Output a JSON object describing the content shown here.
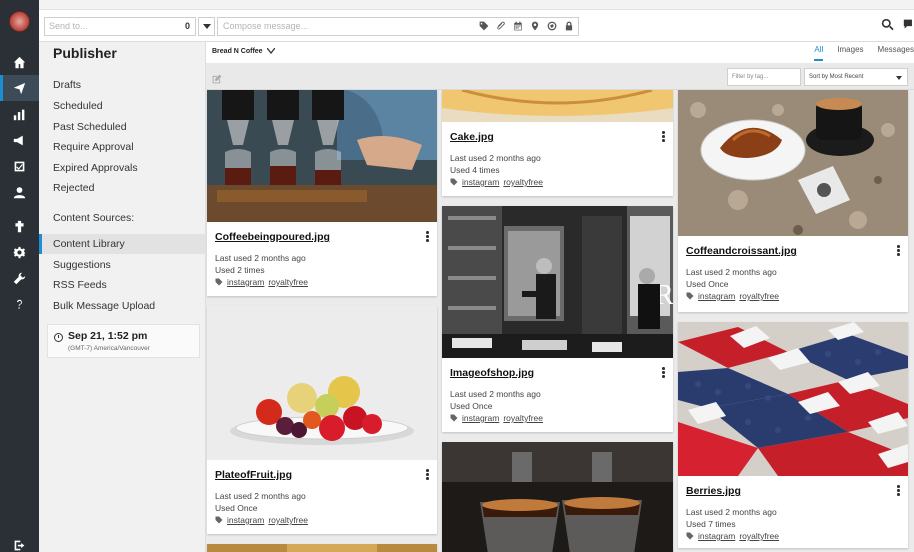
{
  "topbar": {
    "send_to_placeholder": "Send to...",
    "send_to_count": "0",
    "compose_placeholder": "Compose message..."
  },
  "sidebar": {
    "title": "Publisher",
    "items": [
      {
        "label": "Drafts"
      },
      {
        "label": "Scheduled"
      },
      {
        "label": "Past Scheduled"
      },
      {
        "label": "Require Approval"
      },
      {
        "label": "Expired Approvals"
      },
      {
        "label": "Rejected"
      }
    ],
    "sources_heading": "Content Sources:",
    "sources": [
      {
        "label": "Content Library",
        "selected": true
      },
      {
        "label": "Suggestions"
      },
      {
        "label": "RSS Feeds"
      },
      {
        "label": "Bulk Message Upload"
      }
    ],
    "time": "Sep 21, 1:52 pm",
    "timezone": "(GMT-7) America/Vancouver"
  },
  "content": {
    "account": "Bread N Coffee",
    "tabs": [
      {
        "label": "All",
        "active": true
      },
      {
        "label": "Images"
      },
      {
        "label": "Messages"
      }
    ],
    "tag_filter_placeholder": "Filter by tag...",
    "sort_label": "Sort by Most Recent"
  },
  "cards": [
    {
      "name": "Coffeebeingpoured.jpg",
      "last_used": "Last used 2 months ago",
      "used": "Used 2 times",
      "tags": [
        "instagram",
        "royaltyfree"
      ]
    },
    {
      "name": "PlateofFruit.jpg",
      "last_used": "Last used 2 months ago",
      "used": "Used Once",
      "tags": [
        "instagram",
        "royaltyfree"
      ]
    },
    {
      "name": "Cake.jpg",
      "last_used": "Last used 2 months ago",
      "used": "Used 4 times",
      "tags": [
        "instagram",
        "royaltyfree"
      ]
    },
    {
      "name": "Imageofshop.jpg",
      "last_used": "Last used 2 months ago",
      "used": "Used Once",
      "tags": [
        "instagram",
        "royaltyfree"
      ]
    },
    {
      "name": "Coffeandcroissant.jpg",
      "last_used": "Last used 2 months ago",
      "used": "Used Once",
      "tags": [
        "instagram",
        "royaltyfree"
      ]
    },
    {
      "name": "Berries.jpg",
      "last_used": "Last used 2 months ago",
      "used": "Used 7 times",
      "tags": [
        "instagram",
        "royaltyfree"
      ]
    }
  ]
}
